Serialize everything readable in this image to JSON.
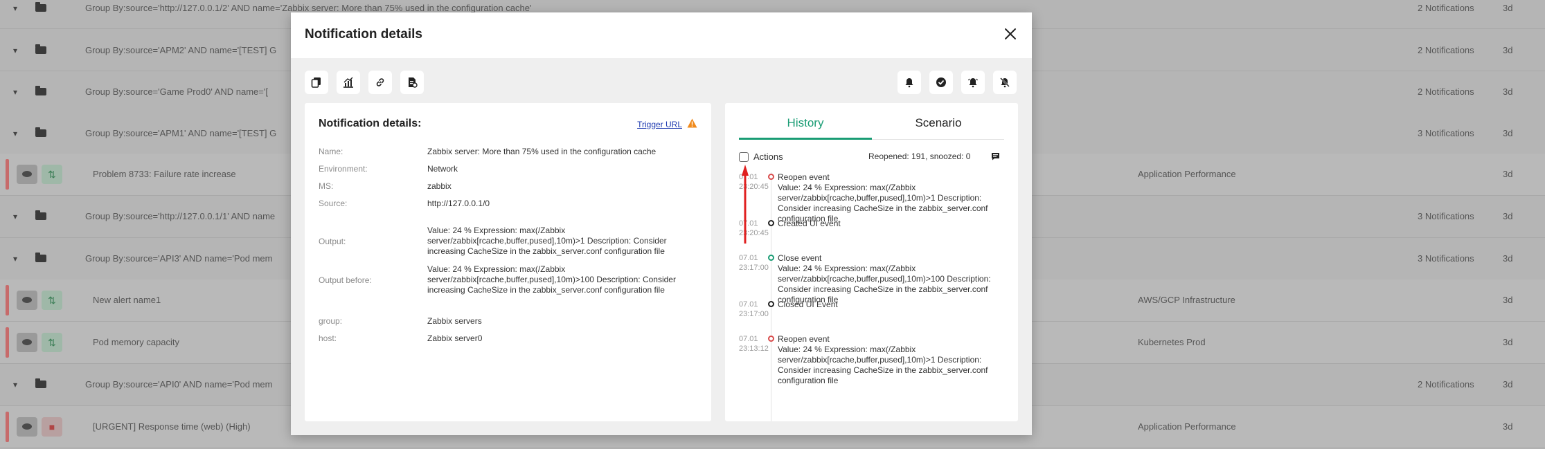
{
  "background": {
    "rows": [
      {
        "title": "Group By:source='http://127.0.0.1/2' AND name='Zabbix server: More than 75% used in the configuration cache'",
        "env": "",
        "count": "2 Notifications",
        "age": "3d"
      },
      {
        "title": "Group By:source='APM2' AND name='[TEST] G",
        "env": "",
        "count": "2 Notifications",
        "age": "3d"
      },
      {
        "title": "Group By:source='Game Prod0' AND name='[",
        "env": "",
        "count": "2 Notifications",
        "age": "3d"
      },
      {
        "title": "Group By:source='APM1' AND name='[TEST] G",
        "env": "",
        "count": "3 Notifications",
        "age": "3d"
      },
      {
        "title": "Problem 8733: Failure rate increase",
        "env": "Application Performance",
        "count": "",
        "age": "3d"
      },
      {
        "title": "Group By:source='http://127.0.0.1/1' AND name",
        "env": "",
        "count": "3 Notifications",
        "age": "3d"
      },
      {
        "title": "Group By:source='API3' AND name='Pod mem",
        "env": "",
        "count": "3 Notifications",
        "age": "3d"
      },
      {
        "title": "New alert name1",
        "env": "AWS/GCP Infrastructure",
        "count": "",
        "age": "3d"
      },
      {
        "title": "Pod memory capacity",
        "env": "Kubernetes Prod",
        "count": "",
        "age": "3d"
      },
      {
        "title": "Group By:source='API0' AND name='Pod mem",
        "env": "",
        "count": "2 Notifications",
        "age": "3d"
      },
      {
        "title": "[URGENT] Response time (web) (High)",
        "env": "Application Performance",
        "count": "",
        "age": "3d"
      }
    ]
  },
  "modal": {
    "title": "Notification details",
    "toolbar_left": [
      "copy-icon",
      "chart-icon",
      "link-icon",
      "document-icon"
    ],
    "toolbar_right": [
      "snooze-icon",
      "resolve-icon",
      "alert-icon",
      "mute-icon"
    ],
    "details": {
      "title": "Notification details:",
      "trigger_url": "Trigger URL",
      "fields": [
        {
          "label": "Name:",
          "value": "Zabbix server: More than 75% used in the configuration cache"
        },
        {
          "label": "Environment:",
          "value": "Network"
        },
        {
          "label": "MS:",
          "value": "zabbix"
        },
        {
          "label": "Source:",
          "value": "http://127.0.0.1/0"
        },
        {
          "label": "Output:",
          "value": "Value: 24 % Expression: max(/Zabbix server/zabbix[rcache,buffer,pused],10m)>1 Description: Consider increasing CacheSize in the zabbix_server.conf configuration file"
        },
        {
          "label": "Output before:",
          "value": "Value: 24 % Expression: max(/Zabbix server/zabbix[rcache,buffer,pused],10m)>100 Description: Consider increasing CacheSize in the zabbix_server.conf configuration file"
        },
        {
          "label": "group:",
          "value": "Zabbix servers"
        },
        {
          "label": "host:",
          "value": "Zabbix server0"
        }
      ]
    },
    "history": {
      "tabs": [
        "History",
        "Scenario"
      ],
      "actions_label": "Actions",
      "reopened_text": "Reopened: 191, snoozed: 0",
      "events": [
        {
          "date": "07.01",
          "time": "23:20:45",
          "dot": "red",
          "title": "Reopen event",
          "detail": "Value: 24 % Expression: max(/Zabbix server/zabbix[rcache,buffer,pused],10m)>1 Description: Consider increasing CacheSize in the zabbix_server.conf configuration file"
        },
        {
          "date": "07.01",
          "time": "23:20:45",
          "dot": "dark",
          "title": "Created UI event",
          "detail": ""
        },
        {
          "date": "07.01",
          "time": "23:17:00",
          "dot": "green",
          "title": "Close event",
          "detail": "Value: 24 % Expression: max(/Zabbix server/zabbix[rcache,buffer,pused],10m)>100 Description: Consider increasing CacheSize in the zabbix_server.conf configuration file"
        },
        {
          "date": "07.01",
          "time": "23:17:00",
          "dot": "dark",
          "title": "Closed UI Event",
          "detail": ""
        },
        {
          "date": "07.01",
          "time": "23:13:12",
          "dot": "red",
          "title": "Reopen event",
          "detail": "Value: 24 % Expression: max(/Zabbix server/zabbix[rcache,buffer,pused],10m)>1 Description: Consider increasing CacheSize in the zabbix_server.conf configuration file"
        }
      ]
    }
  }
}
